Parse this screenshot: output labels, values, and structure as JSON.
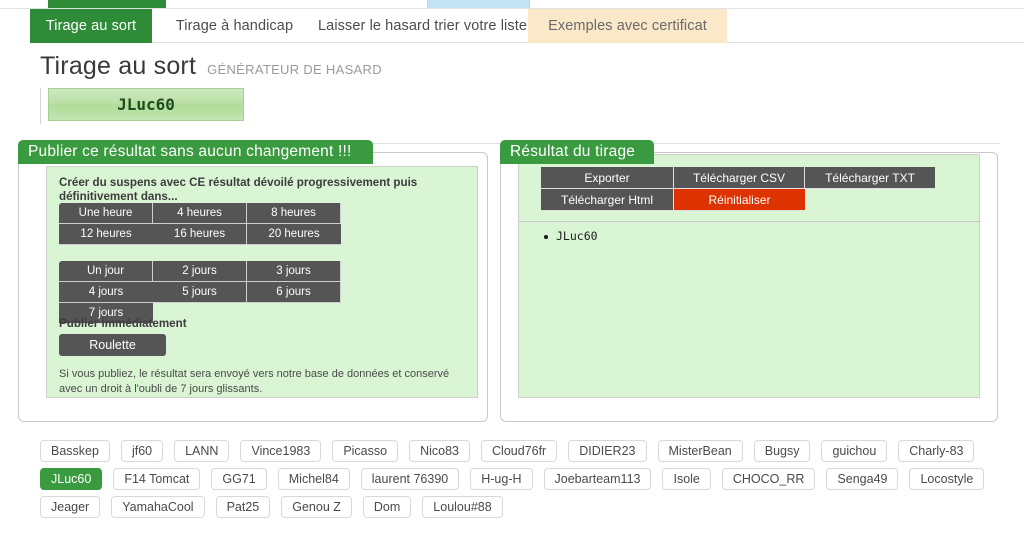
{
  "topstrip": {
    "green_marker": "",
    "blue_marker": ""
  },
  "tabs": [
    {
      "label": "Tirage au sort",
      "state": "active"
    },
    {
      "label": "Tirage à handicap",
      "state": "normal"
    },
    {
      "label": "Laisser le hasard trier votre liste",
      "state": "normal"
    },
    {
      "label": "Exemples avec certificat",
      "state": "cream"
    }
  ],
  "header": {
    "title": "Tirage au sort",
    "subtitle": "GÉNÉRATEUR DE HASARD"
  },
  "winner": {
    "name": "JLuc60"
  },
  "left_panel": {
    "legend": "Publier ce résultat sans aucun changement !!!",
    "lead": "Créer du suspens avec CE résultat dévoilé progressivement puis définitivement dans...",
    "hours_buttons": [
      "Une heure",
      "4 heures",
      "8 heures",
      "12 heures",
      "16 heures",
      "20 heures"
    ],
    "days_buttons": [
      "Un jour",
      "2 jours",
      "3 jours",
      "4 jours",
      "5 jours",
      "6 jours",
      "7 jours"
    ],
    "immediate_label": "Publier immédiatement",
    "roulette_button": "Roulette",
    "note": "Si vous publiez, le résultat sera envoyé vers notre base de données et conservé avec un droit à l'oubli de 7 jours glissants."
  },
  "right_panel": {
    "legend": "Résultat du tirage",
    "actions": [
      {
        "label": "Exporter",
        "style": "normal"
      },
      {
        "label": "Télécharger CSV",
        "style": "normal"
      },
      {
        "label": "Télécharger TXT",
        "style": "normal"
      },
      {
        "label": "Télécharger Html",
        "style": "normal"
      },
      {
        "label": "Réinitialiser",
        "style": "danger"
      }
    ],
    "results": [
      "JLuc60"
    ]
  },
  "tags": [
    {
      "label": "Basskep",
      "selected": false
    },
    {
      "label": "jf60",
      "selected": false
    },
    {
      "label": "LANN",
      "selected": false
    },
    {
      "label": "Vince1983",
      "selected": false
    },
    {
      "label": "Picasso",
      "selected": false
    },
    {
      "label": "Nico83",
      "selected": false
    },
    {
      "label": "Cloud76fr",
      "selected": false
    },
    {
      "label": "DIDIER23",
      "selected": false
    },
    {
      "label": "MisterBean",
      "selected": false
    },
    {
      "label": "Bugsy",
      "selected": false
    },
    {
      "label": "guichou",
      "selected": false
    },
    {
      "label": "Charly-83",
      "selected": false
    },
    {
      "label": "JLuc60",
      "selected": true
    },
    {
      "label": "F14 Tomcat",
      "selected": false
    },
    {
      "label": "GG71",
      "selected": false
    },
    {
      "label": "Michel84",
      "selected": false
    },
    {
      "label": "laurent 76390",
      "selected": false
    },
    {
      "label": "H-ug-H",
      "selected": false
    },
    {
      "label": "Joebarteam113",
      "selected": false
    },
    {
      "label": "Isole",
      "selected": false
    },
    {
      "label": "CHOCO_RR",
      "selected": false
    },
    {
      "label": "Senga49",
      "selected": false
    },
    {
      "label": "Locostyle",
      "selected": false
    },
    {
      "label": "Jeager",
      "selected": false
    },
    {
      "label": "YamahaCool",
      "selected": false
    },
    {
      "label": "Pat25",
      "selected": false
    },
    {
      "label": "Genou Z",
      "selected": false
    },
    {
      "label": "Dom",
      "selected": false
    },
    {
      "label": "Loulou#88",
      "selected": false
    }
  ],
  "colors": {
    "brand_green": "#3a9a3f",
    "tab_active_green": "#2e8b37",
    "tab_cream": "#fbe8c8",
    "panel_fill": "#d9f5d4",
    "button_gray": "#555555",
    "danger_orange": "#dd3300"
  }
}
